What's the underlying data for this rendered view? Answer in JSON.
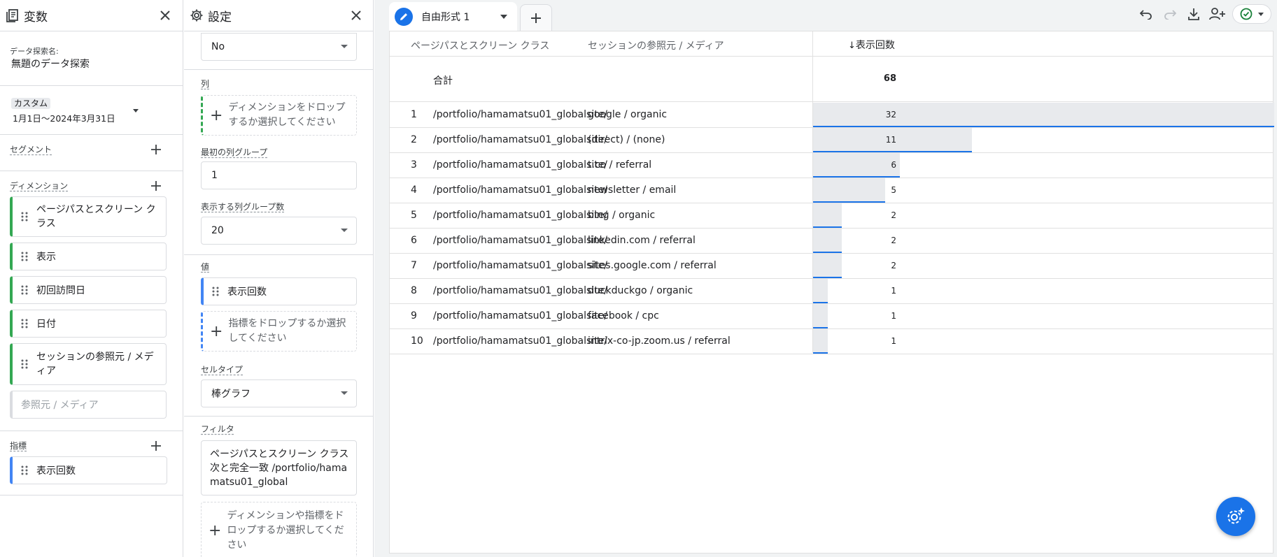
{
  "variables": {
    "title": "変数",
    "exploration_label": "データ探索名:",
    "exploration_name": "無題のデータ探索",
    "date_badge": "カスタム",
    "date_range": "1月1日～2024年3月31日",
    "segments_label": "セグメント",
    "dimensions_label": "ディメンション",
    "dimensions": [
      "ページパスとスクリーン クラス",
      "表示",
      "初回訪問日",
      "日付",
      "セッションの参照元 / メディア"
    ],
    "dimension_placeholder": "参照元 / メディア",
    "metrics_label": "指標",
    "metrics": [
      "表示回数"
    ]
  },
  "settings": {
    "title": "設定",
    "top_select": "No",
    "columns_label": "列",
    "columns_drop": "ディメンションをドロップするか選択してください",
    "first_group_label": "最初の列グループ",
    "first_group_value": "1",
    "group_count_label": "表示する列グループ数",
    "group_count_value": "20",
    "values_label": "値",
    "value_chip": "表示回数",
    "values_drop": "指標をドロップするか選択してください",
    "cell_type_label": "セルタイプ",
    "cell_type_value": "棒グラフ",
    "filter_label": "フィルタ",
    "filter_text": "ページパスとスクリーン クラス 次と完全一致 /portfolio/hamamatsu01_global",
    "filter_drop": "ディメンションや指標をドロップするか選択してください"
  },
  "tab": {
    "name": "自由形式 1"
  },
  "table": {
    "headers": {
      "col1": "ページパスとスクリーン クラス",
      "col2": "セッションの参照元 / メディア",
      "metric": "表示回数",
      "sort_arrow": "↓"
    },
    "total_label": "合計",
    "total_value": "68",
    "max_value": 32,
    "rows": [
      {
        "idx": "1",
        "path": "/portfolio/hamamatsu01_globalsite/",
        "source": "google / organic",
        "value": "32"
      },
      {
        "idx": "2",
        "path": "/portfolio/hamamatsu01_globalsite/",
        "source": "(direct) / (none)",
        "value": "11"
      },
      {
        "idx": "3",
        "path": "/portfolio/hamamatsu01_globalsite/",
        "source": "t.co / referral",
        "value": "6"
      },
      {
        "idx": "4",
        "path": "/portfolio/hamamatsu01_globalsite/",
        "source": "newsletter / email",
        "value": "5"
      },
      {
        "idx": "5",
        "path": "/portfolio/hamamatsu01_globalsite/",
        "source": "bing / organic",
        "value": "2"
      },
      {
        "idx": "6",
        "path": "/portfolio/hamamatsu01_globalsite/",
        "source": "linkedin.com / referral",
        "value": "2"
      },
      {
        "idx": "7",
        "path": "/portfolio/hamamatsu01_globalsite/",
        "source": "sites.google.com / referral",
        "value": "2"
      },
      {
        "idx": "8",
        "path": "/portfolio/hamamatsu01_globalsite/",
        "source": "duckduckgo / organic",
        "value": "1"
      },
      {
        "idx": "9",
        "path": "/portfolio/hamamatsu01_globalsite/",
        "source": "facebook / cpc",
        "value": "1"
      },
      {
        "idx": "10",
        "path": "/portfolio/hamamatsu01_globalsite/",
        "source": "intrix-co-jp.zoom.us / referral",
        "value": "1"
      }
    ]
  },
  "colors": {
    "accent": "#1a73e8",
    "dimension": "#34a853",
    "metric": "#4285f4",
    "bar_fill": "#e8eaed"
  }
}
